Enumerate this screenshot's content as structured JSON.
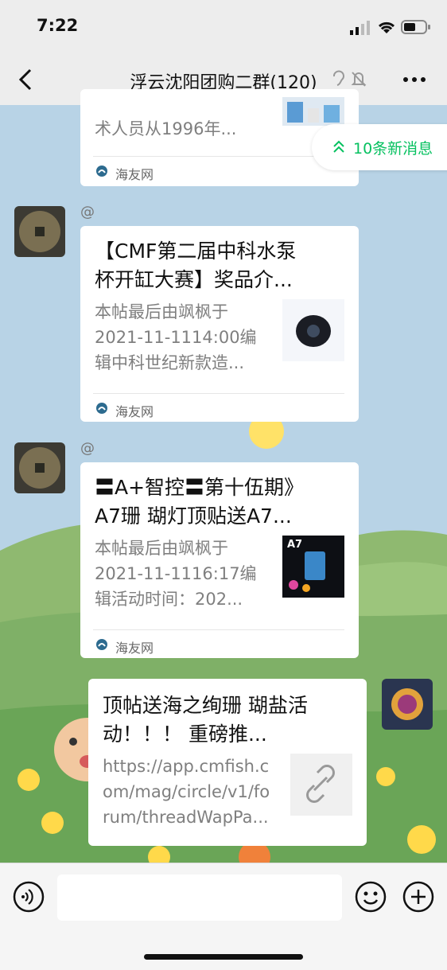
{
  "status": {
    "time": "7:22"
  },
  "header": {
    "title": "浮云沈阳团购二群(120)"
  },
  "new_messages": {
    "label": "10条新消息"
  },
  "messages": [
    {
      "desc_tail": "术人员从1996年...",
      "source": "海友网"
    },
    {
      "at": "@",
      "title_lines": [
        "【CMF第二届中科水泵",
        "杯开缸大赛】奖品介..."
      ],
      "desc_lines": [
        "本帖最后由飒枫于",
        "2021-11-1114:00编",
        "辑中科世纪新款造..."
      ],
      "source": "海友网"
    },
    {
      "at": "@",
      "title_lines": [
        "〓A+智控〓第十伍期》",
        "A7珊 瑚灯顶贴送A7..."
      ],
      "desc_lines": [
        "本帖最后由飒枫于",
        "2021-11-1116:17编",
        "辑活动时间：202..."
      ],
      "source": "海友网",
      "thumb_label": "A7"
    },
    {
      "title_lines": [
        "顶帖送海之绚珊 瑚盐活",
        "动！！！ 重磅推..."
      ],
      "url_lines": [
        "https://app.cmfish.c",
        "om/mag/circle/v1/fo",
        "rum/threadWapPa..."
      ]
    }
  ]
}
